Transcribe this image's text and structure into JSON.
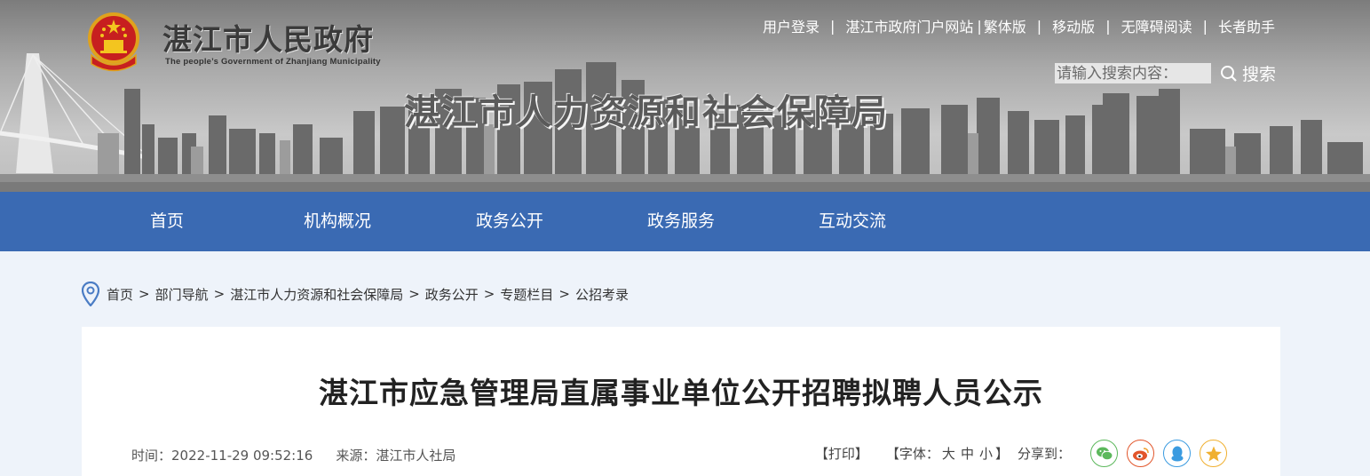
{
  "header": {
    "gov_name": "湛江市人民政府",
    "gov_name_en": "The people’s Government of Zhanjiang Municipality",
    "bureau_name": "湛江市人力资源和社会保障局",
    "top_links": [
      "用户登录",
      "湛江市政府门户网站",
      "繁体版",
      "移动版",
      "无障碍阅读",
      "长者助手"
    ],
    "search_placeholder": "请输入搜索内容：",
    "search_button": "搜索"
  },
  "nav": {
    "items": [
      "首页",
      "机构概况",
      "政务公开",
      "政务服务",
      "互动交流"
    ]
  },
  "breadcrumb": [
    "首页",
    "部门导航",
    "湛江市人力资源和社会保障局",
    "政务公开",
    "专题栏目",
    "公招考录"
  ],
  "article": {
    "title": "湛江市应急管理局直属事业单位公开招聘拟聘人员公示",
    "time_label": "时间：",
    "time_value": "2022-11-29 09:52:16",
    "source_label": "来源：",
    "source_value": "湛江市人社局"
  },
  "tools": {
    "print_open": "【",
    "print": "打印",
    "print_close": "】",
    "font_open": "【字体：",
    "font_sizes": [
      "大",
      "中",
      "小"
    ],
    "font_close": "】",
    "share_label": "分享到：",
    "share_icons": [
      {
        "name": "wechat-icon",
        "color": "#5cb85c"
      },
      {
        "name": "weibo-icon",
        "color": "#e2562b"
      },
      {
        "name": "qq-icon",
        "color": "#3b9be0"
      },
      {
        "name": "qzone-icon",
        "color": "#f0b030"
      }
    ]
  },
  "colors": {
    "nav_bg": "#3a6ab3",
    "page_bg": "#eef3fa"
  }
}
